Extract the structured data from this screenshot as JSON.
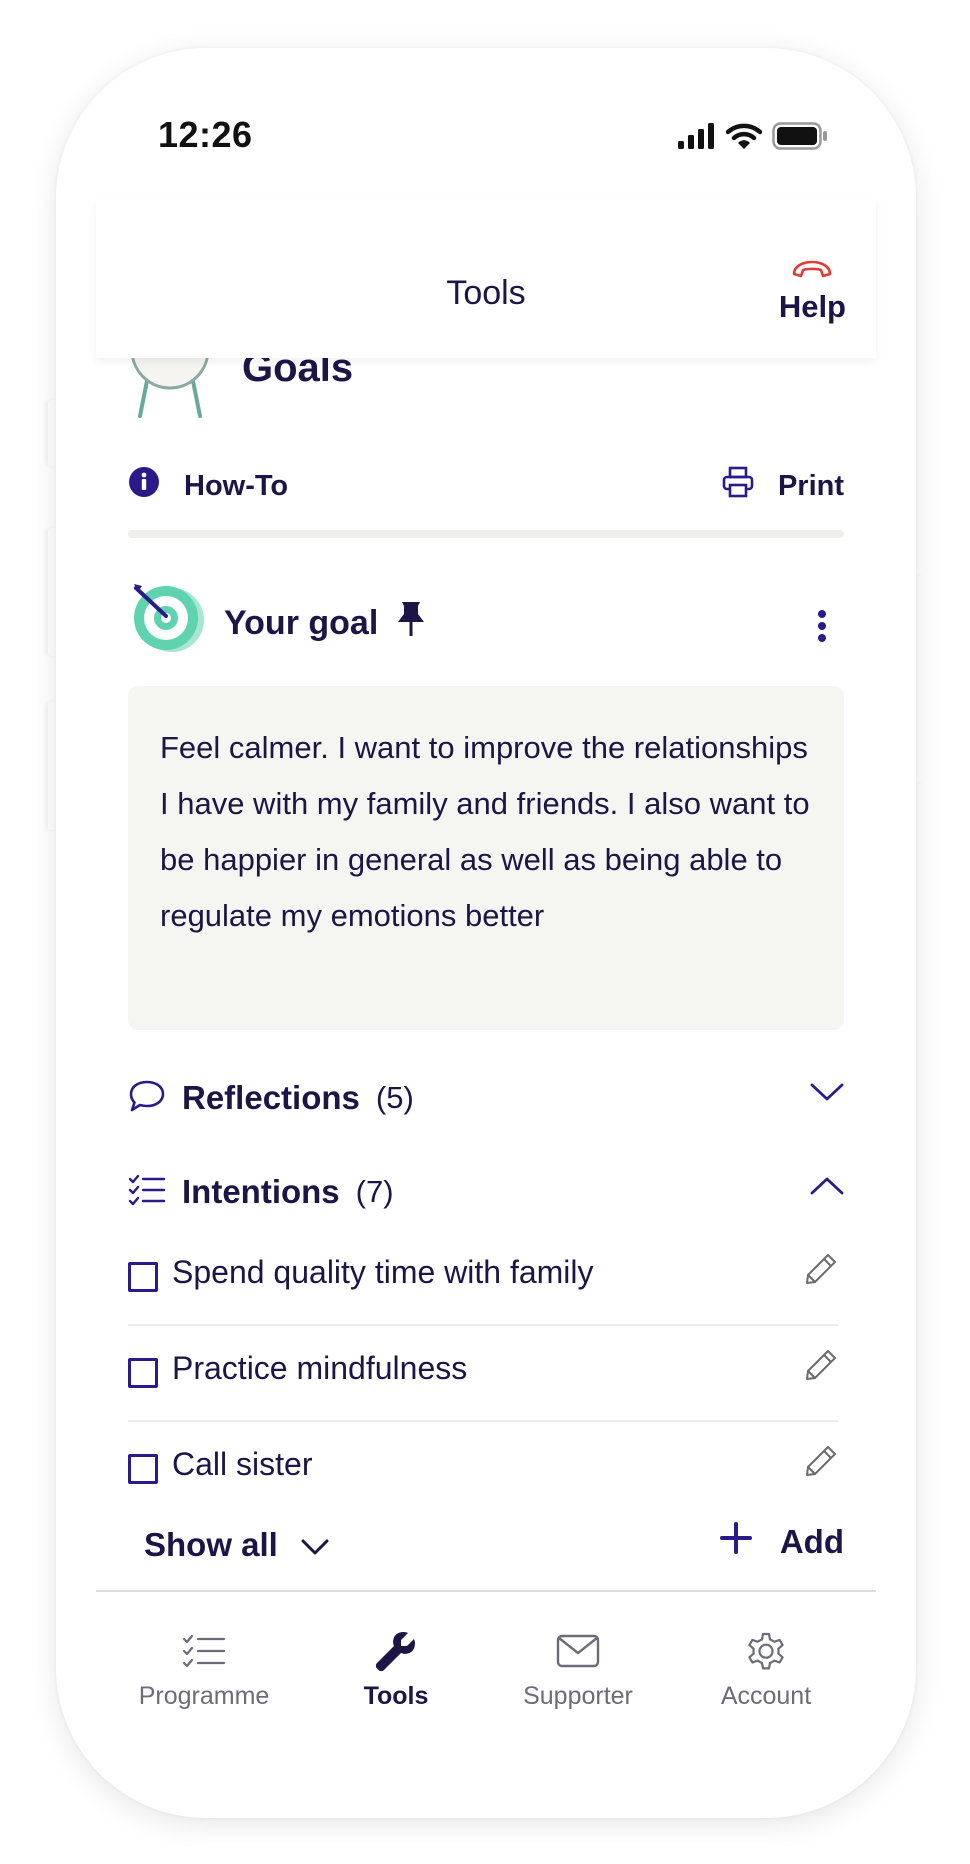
{
  "status_bar": {
    "time": "12:26"
  },
  "header": {
    "title": "Tools",
    "help_label": "Help"
  },
  "page": {
    "title": "Goals",
    "toolbar": {
      "howto_label": "How-To",
      "print_label": "Print"
    }
  },
  "goal": {
    "title": "Your goal",
    "text": "Feel calmer. I want to improve the relationships I have with my family and friends. I also want to be happier in general as well as being able to regulate my emotions better"
  },
  "reflections": {
    "label": "Reflections",
    "count": "(5)"
  },
  "intentions": {
    "label": "Intentions",
    "count": "(7)",
    "items": [
      {
        "label": "Spend quality time with family"
      },
      {
        "label": "Practice mindfulness"
      },
      {
        "label": "Call sister"
      }
    ],
    "show_all_label": "Show all",
    "add_label": "Add"
  },
  "tabbar": {
    "items": [
      {
        "label": "Programme"
      },
      {
        "label": "Tools"
      },
      {
        "label": "Supporter"
      },
      {
        "label": "Account"
      }
    ]
  },
  "colors": {
    "primary": "#1d1546",
    "accent": "#2a1a8a",
    "help_red": "#e53935",
    "goal_box": "#f5f5f1",
    "target_green": "#5fd3b0"
  }
}
